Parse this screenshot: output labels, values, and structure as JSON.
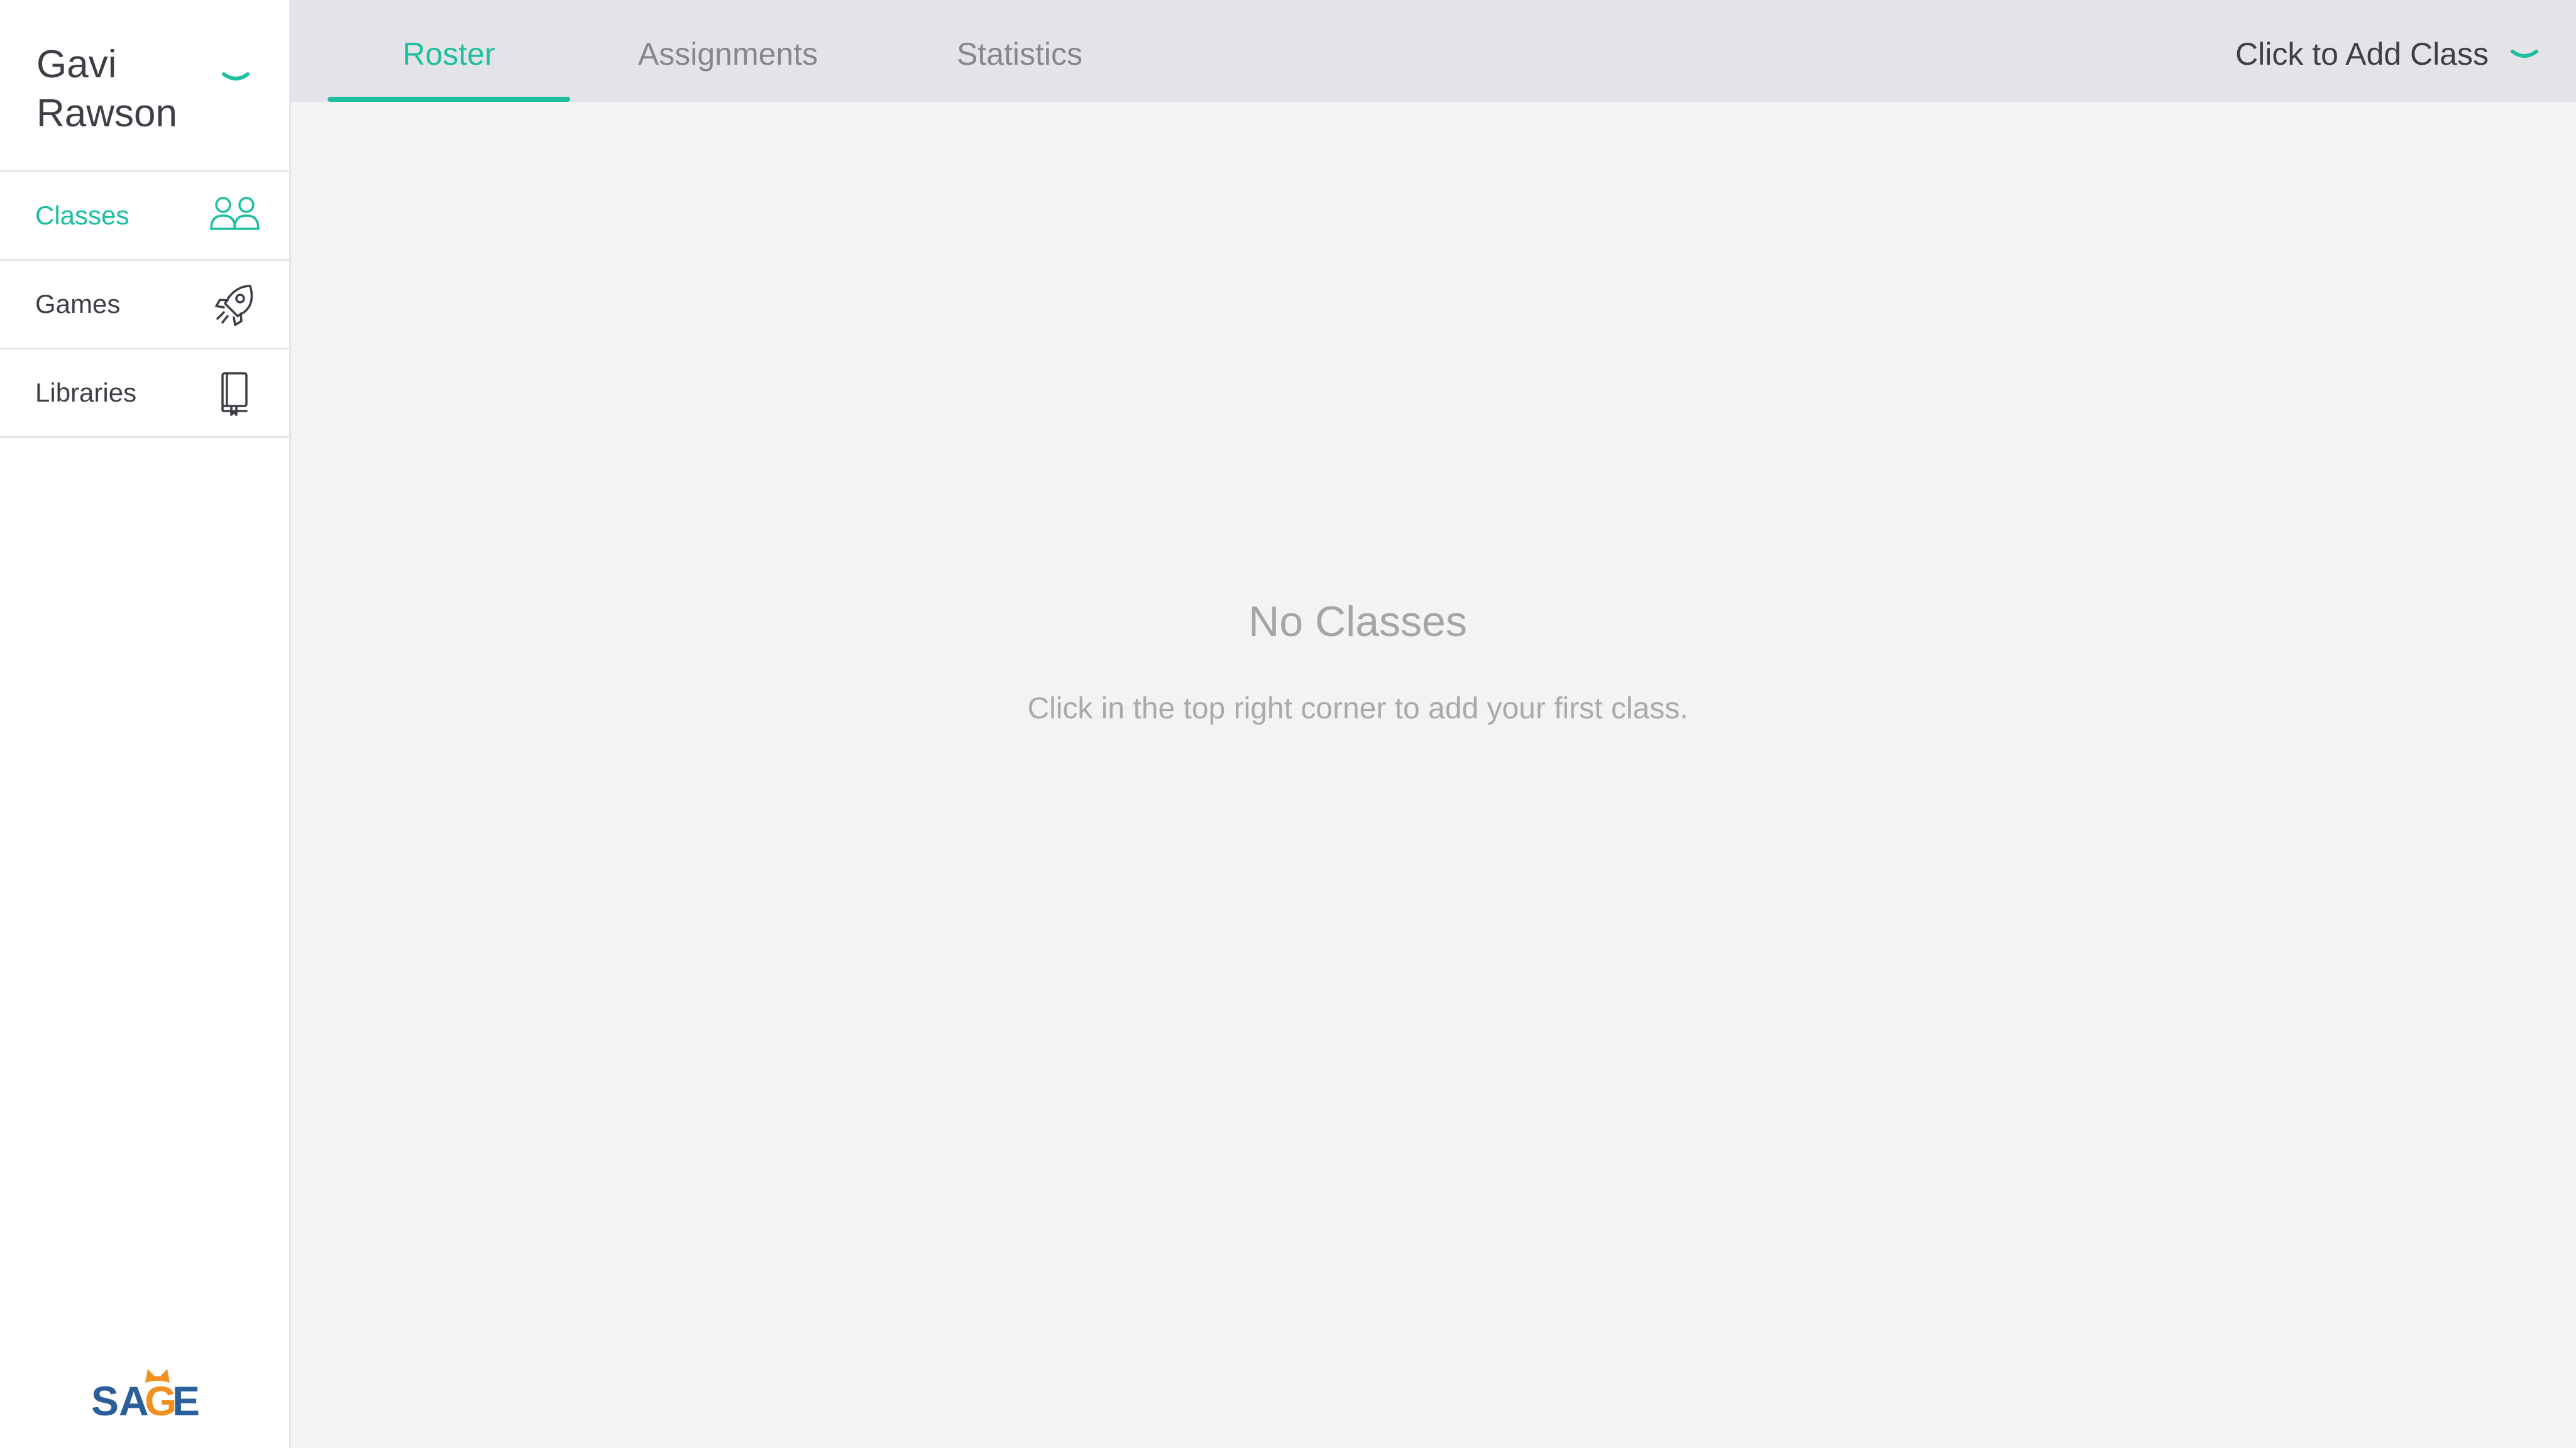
{
  "user": {
    "first_name": "Gavi",
    "last_name": "Rawson"
  },
  "sidebar": {
    "items": [
      {
        "label": "Classes",
        "icon": "classes-icon",
        "active": true
      },
      {
        "label": "Games",
        "icon": "rocket-icon",
        "active": false
      },
      {
        "label": "Libraries",
        "icon": "book-icon",
        "active": false
      }
    ],
    "logo": {
      "text_before": "SA",
      "text_g": "G",
      "text_after": "E"
    }
  },
  "header": {
    "tabs": [
      {
        "label": "Roster",
        "active": true
      },
      {
        "label": "Assignments",
        "active": false
      },
      {
        "label": "Statistics",
        "active": false
      }
    ],
    "add_class_label": "Click to Add Class"
  },
  "main": {
    "empty_title": "No Classes",
    "empty_subtitle": "Click in the top right corner to add your first class."
  },
  "colors": {
    "accent": "#1cbfa0",
    "topbar_bg": "#e4e4e8",
    "main_bg": "#f2f3f2",
    "text_dark": "#3c3f46",
    "text_muted": "#a3a5a9",
    "logo_blue": "#2b5f9a",
    "logo_orange": "#f0901e"
  }
}
